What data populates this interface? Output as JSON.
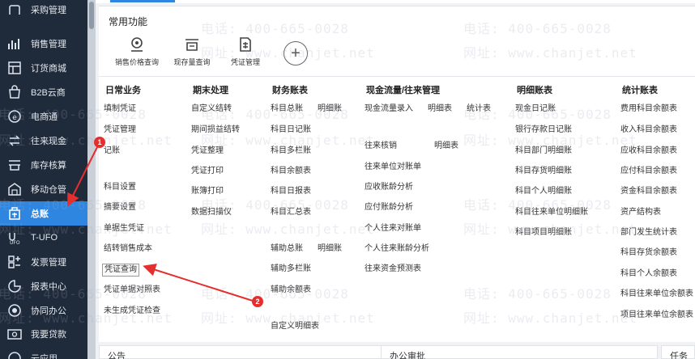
{
  "sidebar": {
    "items": [
      {
        "label": "采购管理",
        "icon": "cart-icon"
      },
      {
        "label": "销售管理",
        "icon": "sales-chart-icon"
      },
      {
        "label": "订货商城",
        "icon": "store-icon"
      },
      {
        "label": "B2B云商",
        "icon": "b2b-bag-icon"
      },
      {
        "label": "电商通",
        "icon": "ecommerce-icon"
      },
      {
        "label": "往来现金",
        "icon": "cash-flow-icon"
      },
      {
        "label": "库存核算",
        "icon": "inventory-icon"
      },
      {
        "label": "移动仓管",
        "icon": "mobile-warehouse-icon"
      },
      {
        "label": "总账",
        "icon": "ledger-icon",
        "active": true
      },
      {
        "label": "T-UFO",
        "icon": "ufo-icon"
      },
      {
        "label": "发票管理",
        "icon": "invoice-icon"
      },
      {
        "label": "报表中心",
        "icon": "report-icon"
      },
      {
        "label": "协同办公",
        "icon": "collab-icon"
      },
      {
        "label": "我要贷款",
        "icon": "loan-icon"
      },
      {
        "label": "云应用",
        "icon": "cloud-app-icon"
      }
    ]
  },
  "common": {
    "title": "常用功能",
    "items": [
      {
        "label": "销售价格查询",
        "icon": "price-query-icon"
      },
      {
        "label": "现存量查询",
        "icon": "stock-query-icon"
      },
      {
        "label": "凭证管理",
        "icon": "voucher-icon"
      }
    ],
    "add_label": "+"
  },
  "columns": [
    {
      "title": "日常业务",
      "links": [
        "填制凭证",
        "凭证管理",
        "记账",
        "科目设置",
        "摘要设置",
        "单据生凭证",
        "结转销售成本",
        "凭证查询",
        "凭证单据对照表",
        "未生成凭证检查"
      ]
    },
    {
      "title": "期末处理",
      "links": [
        "自定义结转",
        "期间损益结转",
        "凭证整理",
        "凭证打印",
        "账簿打印",
        "数据扫描仪"
      ]
    },
    {
      "title": "财务账表",
      "links": [
        "科目总账",
        "明细账",
        "科目日记账",
        "科目多栏账",
        "科目余额表",
        "科目日报表",
        "科目汇总表",
        "辅助总账",
        "明细账",
        "辅助多栏账",
        "辅助余额表",
        "自定义明细表"
      ]
    },
    {
      "title": "现金流量/往来管理",
      "links": [
        "现金流量录入",
        "明细表",
        "统计表",
        "往来核销",
        "明细表",
        "往来单位对账单",
        "应收账龄分析",
        "应付账龄分析",
        "个人往来对账单",
        "个人往来账龄分析",
        "往来资金预测表"
      ]
    },
    {
      "title": "明细账表",
      "links": [
        "现金日记账",
        "银行存款日记账",
        "科目部门明细账",
        "科目存货明细账",
        "科目个人明细账",
        "科目往来单位明细账",
        "科目项目明细账"
      ]
    },
    {
      "title": "统计账表",
      "links": [
        "费用科目余额表",
        "收入科目余额表",
        "应收科目余额表",
        "应付科目余额表",
        "资金科目余额表",
        "资产结构表",
        "部门发生统计表",
        "科目存货余额表",
        "科目个人余额表",
        "科目往来单位余额表",
        "项目往来单位余额表"
      ]
    }
  ],
  "bottom": {
    "card1": "公告",
    "card2": "办公审批",
    "card3": "任务"
  },
  "watermark": {
    "line1": "电话: 400-665-0028",
    "line2": "网址: www.chanjet.net"
  },
  "annotations": {
    "badge1": "1",
    "badge2": "2"
  },
  "colors": {
    "sidebar_bg": "#1f2a3a",
    "active": "#2f86e0",
    "annotation": "#e52e2e"
  }
}
